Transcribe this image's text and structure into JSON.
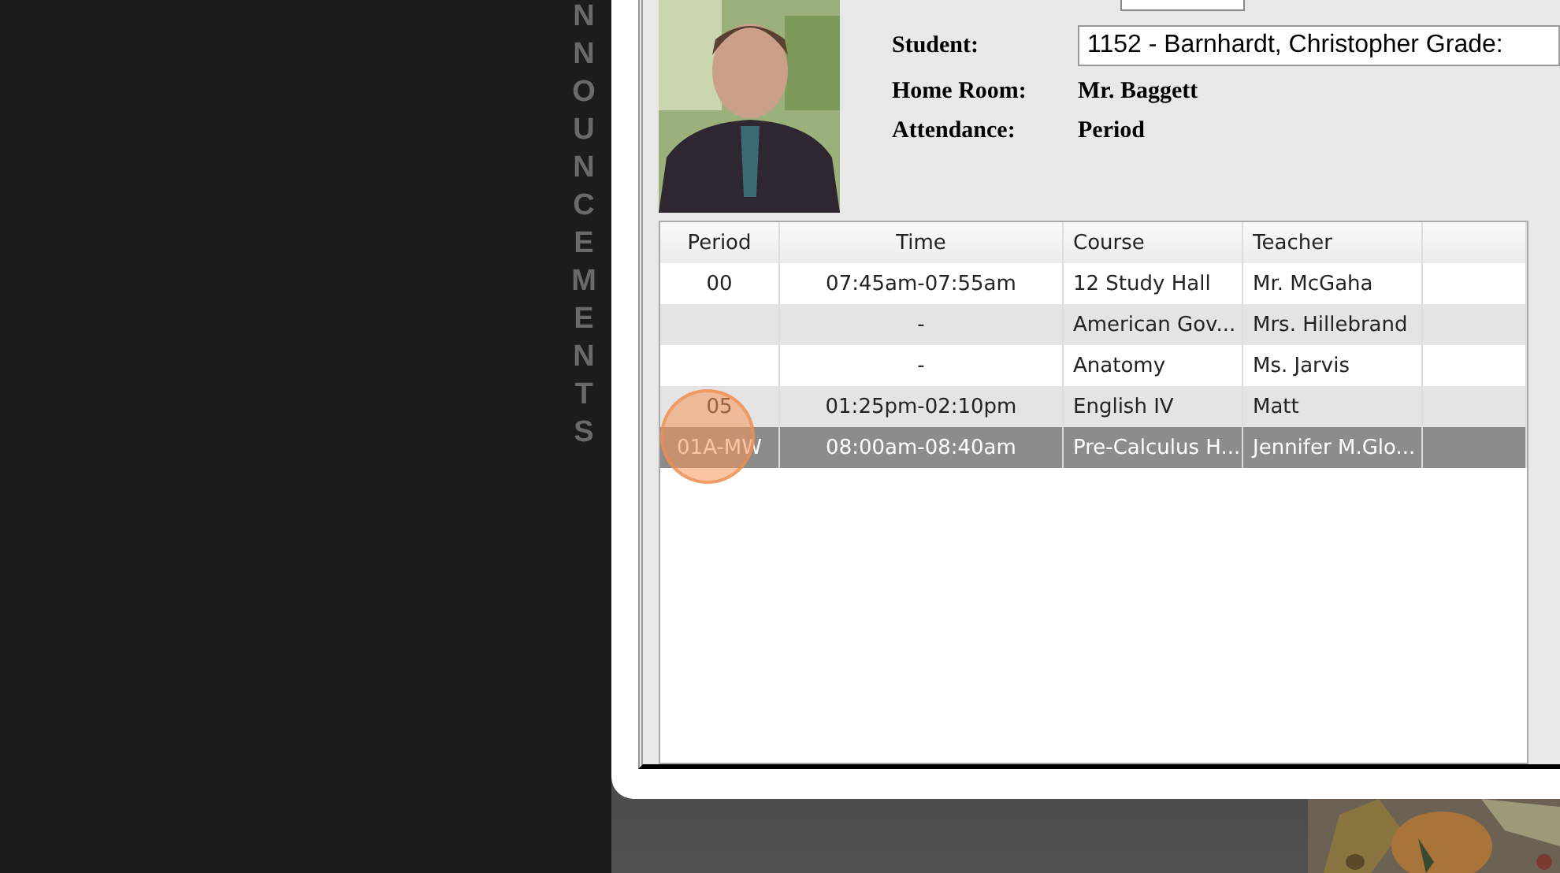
{
  "side_banner": {
    "text": "NNOUNCEMENTS"
  },
  "student": {
    "fields": [
      {
        "kind": "select",
        "label": "Student:",
        "value": "1152 - Barnhardt, Christopher Grade:"
      },
      {
        "kind": "text",
        "label": "Home Room:",
        "value": "Mr. Baggett"
      },
      {
        "kind": "text",
        "label": "Attendance:",
        "value": "Period"
      }
    ]
  },
  "schedule": {
    "columns": [
      "Period",
      "Time",
      "Course",
      "Teacher"
    ],
    "rows": [
      {
        "period": "00",
        "time": "07:45am-07:55am",
        "course": "12 Study Hall",
        "teacher": "Mr. McGaha",
        "selected": false
      },
      {
        "period": "",
        "time": "-",
        "course": "American Gov...",
        "teacher": "Mrs. Hillebrand",
        "selected": false
      },
      {
        "period": "",
        "time": "-",
        "course": "Anatomy",
        "teacher": "Ms. Jarvis",
        "selected": false
      },
      {
        "period": "05",
        "time": "01:25pm-02:10pm",
        "course": "English IV",
        "teacher": "Matt",
        "selected": false
      },
      {
        "period": "01A-MW",
        "time": "08:00am-08:40am",
        "course": "Pre-Calculus H...",
        "teacher": "Jennifer M.Glo...",
        "selected": true
      }
    ]
  }
}
